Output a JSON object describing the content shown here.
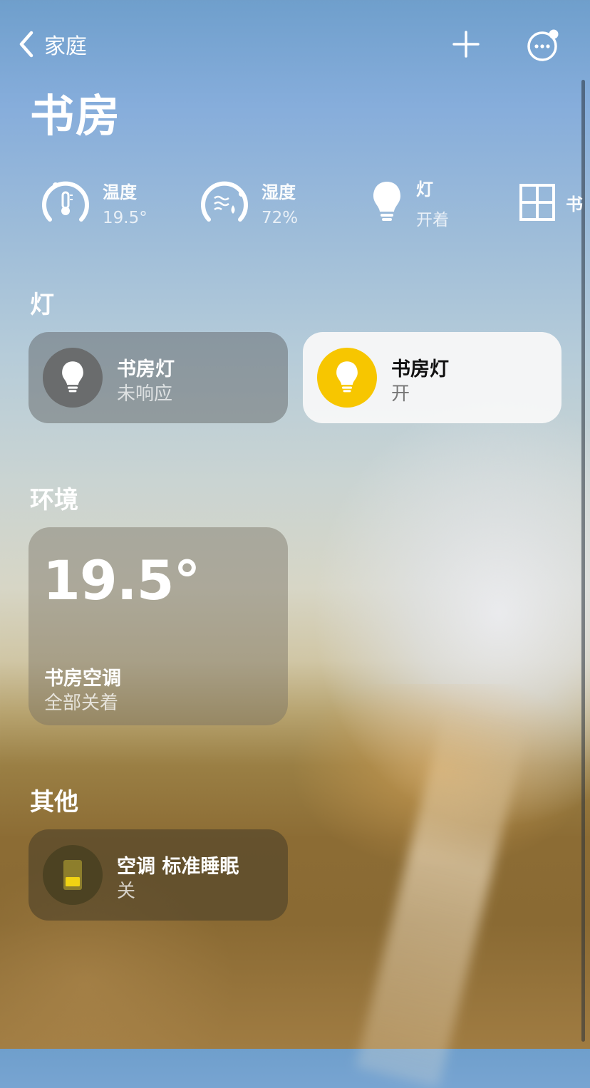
{
  "nav": {
    "back_label": "家庭"
  },
  "page_title": "书房",
  "status": [
    {
      "title": "温度",
      "value": "19.5°"
    },
    {
      "title": "湿度",
      "value": "72%"
    },
    {
      "title": "灯",
      "value": "开着"
    },
    {
      "title": "书"
    }
  ],
  "sections": {
    "lights": "灯",
    "environment": "环境",
    "other": "其他"
  },
  "lights": [
    {
      "name": "书房灯",
      "state": "未响应"
    },
    {
      "name": "书房灯",
      "state": "开"
    }
  ],
  "environment": {
    "temperature": "19.5°",
    "name": "书房空调",
    "state": "全部关着"
  },
  "other": [
    {
      "name": "空调 标准睡眠",
      "state": "关"
    }
  ],
  "colors": {
    "light_on": "#f7c600",
    "icon_dark_bg": "#6b6b6b",
    "ac_icon_bg": "#4c4222",
    "ac_icon": "#f1d313"
  },
  "icons": [
    "chevron-left-icon",
    "plus-icon",
    "more-icon",
    "thermometer-icon",
    "humidity-icon",
    "lightbulb-icon",
    "window-icon",
    "ac-icon"
  ]
}
